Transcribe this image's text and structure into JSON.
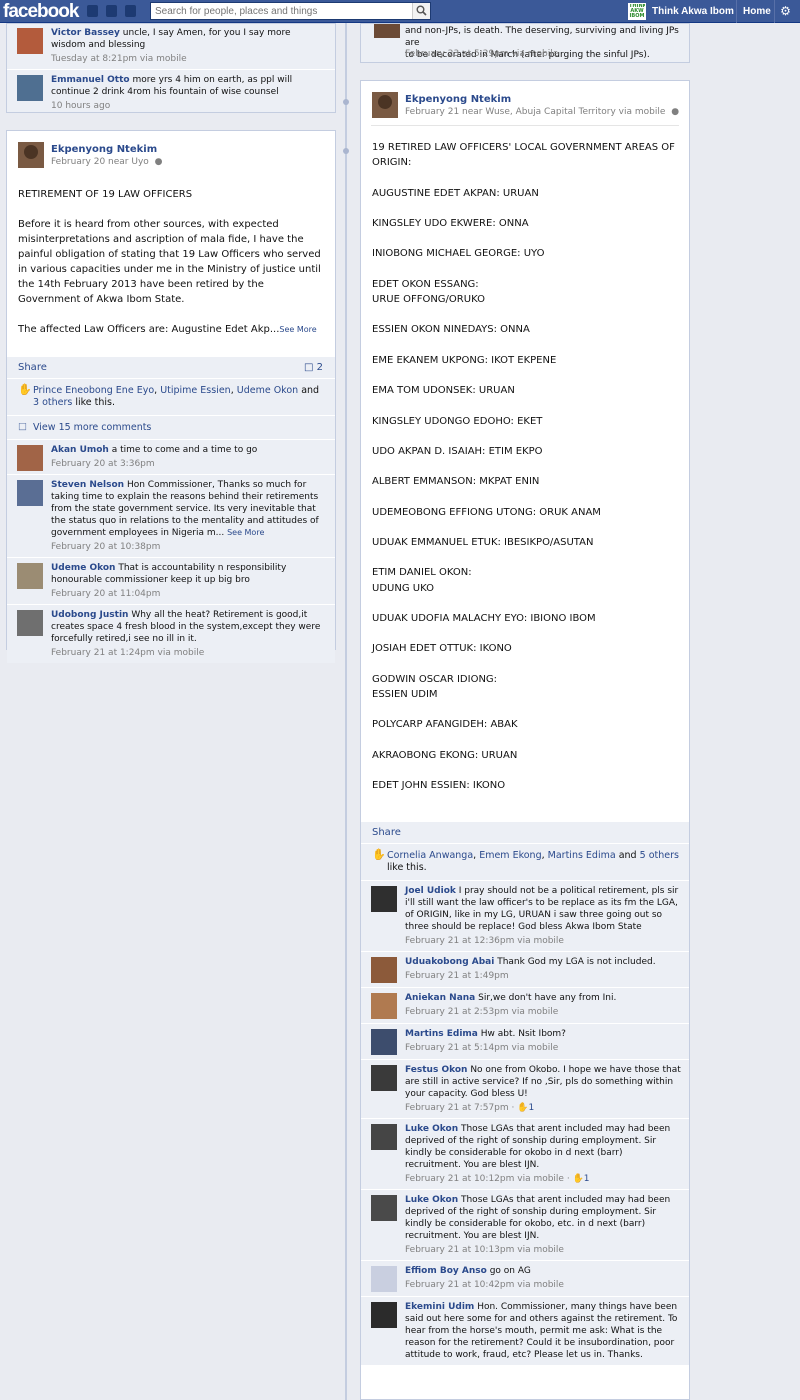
{
  "topbar": {
    "logo": "facebook",
    "search_placeholder": "Search for people, places and things",
    "page_name": "Think Akwa Ibom",
    "page_thumb_text": "THINK AKW IBOM",
    "home": "Home",
    "settings_icon": "gear-icon"
  },
  "left_top_comments": [
    {
      "name": "Victor Bassey",
      "text": "uncle, I say Amen, for you I say more wisdom and blessing",
      "meta": "Tuesday at 8:21pm via mobile"
    },
    {
      "name": "Emmanuel Otto",
      "text": "more yrs 4 him on earth, as ppl will continue 2 drink 4rom his fountain of wise counsel",
      "meta": "10 hours ago"
    }
  ],
  "right_top_fragment": {
    "lines": [
      "and non-JPs, is death. The deserving, surviving and living JPs are",
      "to be decorated in March (after purging the sinful JPs)."
    ],
    "meta": "February 23 at 5:29pm via mobile"
  },
  "post1": {
    "author": "Ekpenyong Ntekim",
    "meta": "February 20 near Uyo",
    "title": "RETIREMENT OF 19 LAW OFFICERS",
    "paragraph1": "Before it is heard from other sources, with expected misinterpretations and ascription of mala fide, I have the painful obligation of stating that 19 Law Officers who served in various capacities under me in the Ministry of justice until the 14th February 2013 have been retired by the Government of Akwa Ibom State.",
    "paragraph2": "The affected Law Officers are: Augustine Edet Akp...",
    "see_more": "See More",
    "share": "Share",
    "comment_count": "2",
    "likes": {
      "names": [
        "Prince Eneobong Ene Eyo",
        "Utipime Essien",
        "Udeme Okon"
      ],
      "and": "and",
      "others": "3 others",
      "suffix": "like this."
    },
    "view_more": "View 15 more comments",
    "comments": [
      {
        "name": "Akan Umoh",
        "text": "a time to come and a time to go",
        "meta": "February 20 at 3:36pm",
        "see_more": ""
      },
      {
        "name": "Steven Nelson",
        "text": "Hon Commissioner, Thanks so much for taking time to explain the reasons behind their retirements from the state government service. Its very inevitable that the status quo in relations to the mentality and attitudes of government employees in Nigeria m...",
        "meta": "February 20 at 10:38pm",
        "see_more": "See More"
      },
      {
        "name": "Udeme Okon",
        "text": "That is accountability n responsibility honourable commissioner keep it up big bro",
        "meta": "February 20 at 11:04pm",
        "see_more": ""
      },
      {
        "name": "Udobong Justin",
        "text": "Why all the heat? Retirement is good,it creates space 4 fresh blood in the system,except they were forcefully retired,i see no ill in it.",
        "meta": "February 21 at 1:24pm via mobile",
        "see_more": ""
      }
    ]
  },
  "post2": {
    "author": "Ekpenyong Ntekim",
    "meta": "February 21 near Wuse, Abuja Capital Territory via mobile",
    "heading": [
      "19 RETIRED LAW OFFICERS' LOCAL GOVERNMENT AREAS OF",
      "ORIGIN:"
    ],
    "officers": [
      [
        "AUGUSTINE EDET AKPAN: URUAN"
      ],
      [
        "KINGSLEY UDO EKWERE: ONNA"
      ],
      [
        "INIOBONG MICHAEL GEORGE: UYO"
      ],
      [
        "EDET OKON ESSANG:",
        "URUE OFFONG/ORUKO"
      ],
      [
        "ESSIEN OKON NINEDAYS: ONNA"
      ],
      [
        "EME EKANEM UKPONG: IKOT EKPENE"
      ],
      [
        "EMA TOM UDONSEK: URUAN"
      ],
      [
        "KINGSLEY UDONGO EDOHO: EKET"
      ],
      [
        "UDO AKPAN D. ISAIAH: ETIM EKPO"
      ],
      [
        "ALBERT EMMANSON: MKPAT ENIN"
      ],
      [
        "UDEMEOBONG EFFIONG UTONG: ORUK ANAM"
      ],
      [
        "UDUAK EMMANUEL ETUK: IBESIKPO/ASUTAN"
      ],
      [
        "ETIM DANIEL OKON:",
        "UDUNG UKO"
      ],
      [
        "UDUAK UDOFIA MALACHY EYO: IBIONO IBOM"
      ],
      [
        "JOSIAH EDET OTTUK: IKONO"
      ],
      [
        "GODWIN OSCAR IDIONG:",
        "ESSIEN UDIM"
      ],
      [
        "POLYCARP AFANGIDEH: ABAK"
      ],
      [
        "AKRAOBONG EKONG: URUAN"
      ],
      [
        "EDET JOHN ESSIEN: IKONO"
      ]
    ],
    "share": "Share",
    "likes": {
      "names": [
        "Cornelia Anwanga",
        "Emem Ekong",
        "Martins Edima"
      ],
      "and": "and",
      "others": "5 others",
      "suffix": "like this."
    },
    "comments": [
      {
        "name": "Joel Udiok",
        "text": "I pray should not be a political retirement, pls sir i'll still want the law officer's to be replace as its fm the LGA, of ORIGIN, like in my LG, URUAN i saw three going out so three should be replace! God bless Akwa Ibom State",
        "meta": "February 21 at 12:36pm via mobile",
        "likes": ""
      },
      {
        "name": "Uduakobong Abai",
        "text": "Thank God my LGA is not included.",
        "meta": "February 21 at 1:49pm",
        "likes": ""
      },
      {
        "name": "Aniekan Nana",
        "text": "Sir,we don't have any from Ini.",
        "meta": "February 21 at 2:53pm via mobile",
        "likes": ""
      },
      {
        "name": "Martins Edima",
        "text": "Hw abt. Nsit Ibom?",
        "meta": "February 21 at 5:14pm via mobile",
        "likes": ""
      },
      {
        "name": "Festus Okon",
        "text": "No one from Okobo. I hope we have those that are still in active service? If no ,Sir, pls do something within your capacity. God bless U!",
        "meta": "February 21 at 7:57pm",
        "likes": "1"
      },
      {
        "name": "Luke Okon",
        "text": "Those LGAs that arent included may had been deprived of the right of sonship during employment. Sir kindly be considerable for okobo in d next (barr) recruitment. You are blest IJN.",
        "meta": "February 21 at 10:12pm via mobile",
        "likes": "1"
      },
      {
        "name": "Luke Okon",
        "text": "Those LGAs that arent included may had been deprived of the right of sonship during employment. Sir kindly be considerable for okobo, etc. in d next (barr) recruitment. You are blest IJN.",
        "meta": "February 21 at 10:13pm via mobile",
        "likes": ""
      },
      {
        "name": "Effiom Boy Anso",
        "text": "go on AG",
        "meta": "February 21 at 10:42pm via mobile",
        "likes": ""
      },
      {
        "name": "Ekemini Udim",
        "text": "Hon. Commissioner, many things have been said out here some for and others against the retirement. To hear from the horse's mouth, permit me ask: What is the reason for the retirement? Could it be insubordination, poor attitude to work, fraud, etc? Please let us in. Thanks.",
        "meta": "",
        "likes": ""
      }
    ]
  }
}
